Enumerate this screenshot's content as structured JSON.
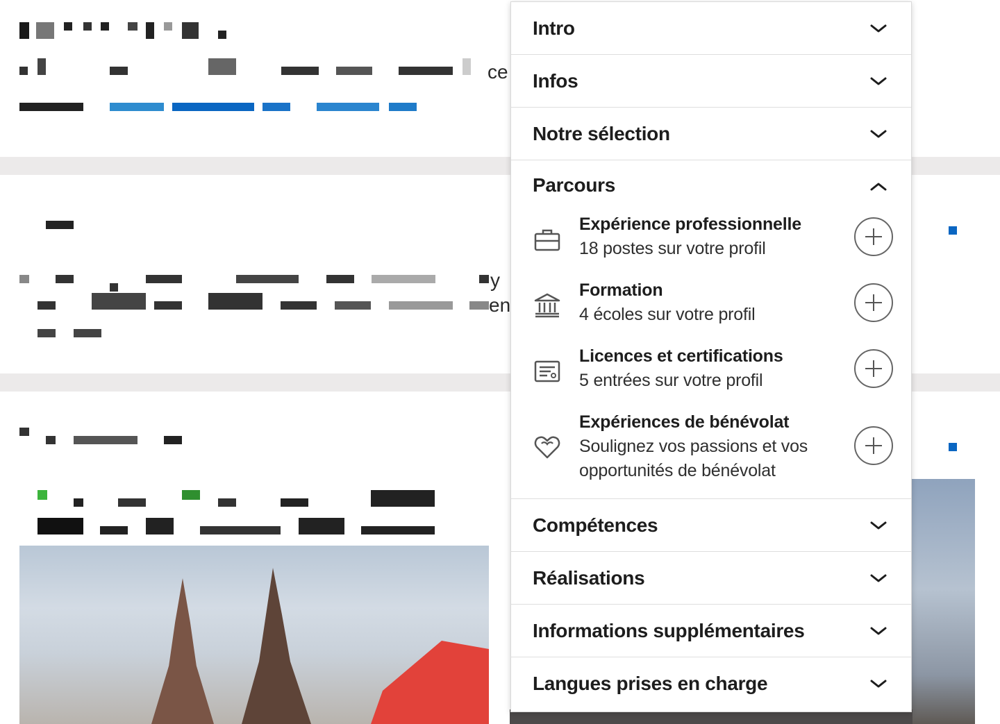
{
  "menu": {
    "sections_top": [
      {
        "label": "Intro",
        "expanded": false
      },
      {
        "label": "Infos",
        "expanded": false
      },
      {
        "label": "Notre sélection",
        "expanded": false
      }
    ],
    "parcours": {
      "label": "Parcours",
      "expanded": true,
      "items": [
        {
          "title": "Expérience professionnelle",
          "desc": "18 postes sur votre profil",
          "icon": "briefcase-icon"
        },
        {
          "title": "Formation",
          "desc": "4 écoles sur votre profil",
          "icon": "school-icon"
        },
        {
          "title": "Licences et certifications",
          "desc": "5 entrées sur votre profil",
          "icon": "certificate-icon"
        },
        {
          "title": "Expériences de bénévolat",
          "desc": "Soulignez vos passions et vos opportunités de bénévolat",
          "icon": "heart-hands-icon"
        }
      ]
    },
    "sections_bottom": [
      {
        "label": "Compétences",
        "expanded": false
      },
      {
        "label": "Réalisations",
        "expanded": false
      },
      {
        "label": "Informations supplémentaires",
        "expanded": false
      },
      {
        "label": "Langues prises en charge",
        "expanded": false
      }
    ]
  },
  "background": {
    "fragments": [
      "ce",
      "y",
      "en"
    ]
  },
  "colors": {
    "accent": "#0a66c2",
    "text": "#1d1d1d",
    "divider": "#dedede"
  }
}
